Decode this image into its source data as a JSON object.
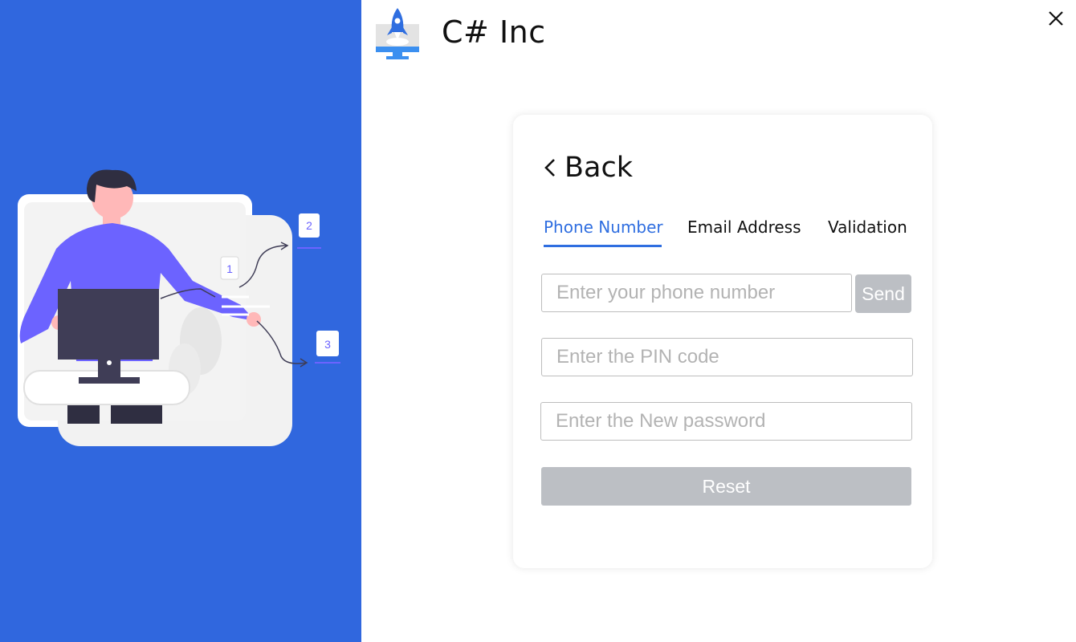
{
  "app": {
    "brand_name": "C# Inc"
  },
  "illustration": {
    "step_labels": [
      "1",
      "2",
      "3"
    ]
  },
  "card": {
    "back_label": "Back",
    "tabs": [
      {
        "label": "Phone Number",
        "active": true
      },
      {
        "label": "Email Address",
        "active": false
      },
      {
        "label": "Validation",
        "active": false
      }
    ],
    "phone_input": {
      "placeholder": "Enter your phone number",
      "value": ""
    },
    "send_label": "Send",
    "pin_input": {
      "placeholder": "Enter the PIN code",
      "value": ""
    },
    "password_input": {
      "placeholder": "Enter the New password",
      "value": ""
    },
    "reset_label": "Reset"
  },
  "colors": {
    "panel_blue": "#3067de",
    "accent": "#2f6ee0",
    "disabled_button": "#bcbfc4",
    "figure_shirt": "#6c63ff"
  },
  "icons": {
    "brand": "rocket-monitor-icon",
    "close": "close-icon",
    "back": "chevron-left-icon"
  }
}
